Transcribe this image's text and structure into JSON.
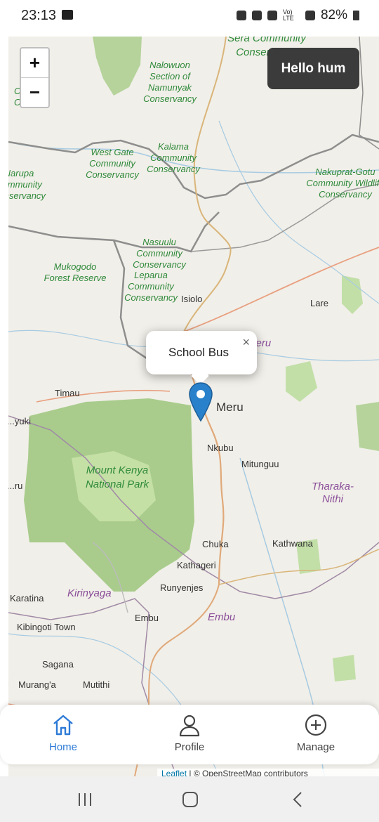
{
  "status_bar": {
    "time": "23:13",
    "signal_label": "Vo) LTE",
    "battery": "82%"
  },
  "map": {
    "zoom_in": "+",
    "zoom_out": "−",
    "greeting": "Hello hum",
    "popup": {
      "text": "School Bus",
      "close": "×"
    },
    "protected_areas": [
      "Sera Community Conservancy",
      "Nalowuon Section of Namunyak Conservancy",
      "Kalama Community Conservancy",
      "West Gate Community Conservancy",
      "Narupa Community Conservancy",
      "Nakuprat-Gotu Community Wildlife Conservancy",
      "Nasuulu Community Conservancy",
      "Leparua Community Conservancy",
      "Mukogodo Forest Reserve",
      "Mount Kenya National Park"
    ],
    "partial_labels": [
      "C... nity",
      "C... ncy",
      "...yuki",
      "...ru",
      "...eru",
      "i"
    ],
    "towns": [
      "Isiolo",
      "Lare",
      "Timau",
      "Meru",
      "Nkubu",
      "Mitunguu",
      "Chuka",
      "Kathwana",
      "Kathageri",
      "Runyenjes",
      "Embu",
      "Karatina",
      "Kibingoti Town",
      "Sagana",
      "Murang'a",
      "Mutithi"
    ],
    "counties": [
      "Tharaka-Nithi",
      "Kirinyaga",
      "Embu"
    ],
    "attribution": {
      "leaflet": "Leaflet",
      "rest": " | © OpenStreetMap contributors"
    }
  },
  "bottom_nav": [
    {
      "label": "Home",
      "icon": "home-icon",
      "active": true
    },
    {
      "label": "Profile",
      "icon": "person-icon",
      "active": false
    },
    {
      "label": "Manage",
      "icon": "plus-circle-icon",
      "active": false
    }
  ],
  "colors": {
    "accent": "#2d7ad6",
    "marker": "#2a81cb",
    "park": "#aacf8f",
    "water": "#a6cbe3"
  }
}
